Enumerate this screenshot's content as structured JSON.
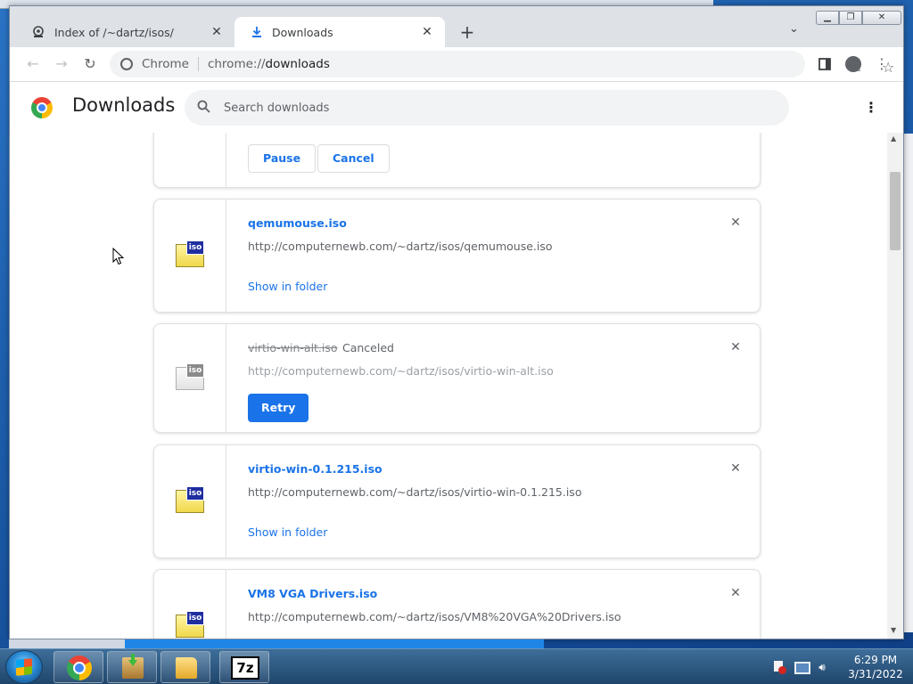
{
  "browser": {
    "tabs": [
      {
        "title": "Index of /~dartz/isos/",
        "icon": "page-icon"
      },
      {
        "title": "Downloads",
        "icon": "download-icon"
      }
    ],
    "omnibox": {
      "site_label": "Chrome",
      "url_scheme": "chrome://",
      "url_host": "downloads"
    }
  },
  "downloads_page": {
    "title": "Downloads",
    "search_placeholder": "Search downloads"
  },
  "active_download": {
    "pause_label": "Pause",
    "cancel_label": "Cancel"
  },
  "items": [
    {
      "name": "qemumouse.iso",
      "url": "http://computernewb.com/~dartz/isos/qemumouse.iso",
      "action": "Show in folder",
      "icon_tag": "iso",
      "state": "complete"
    },
    {
      "name": "virtio-win-alt.iso",
      "status": "Canceled",
      "url": "http://computernewb.com/~dartz/isos/virtio-win-alt.iso",
      "action": "Retry",
      "icon_tag": "iso",
      "state": "canceled"
    },
    {
      "name": "virtio-win-0.1.215.iso",
      "url": "http://computernewb.com/~dartz/isos/virtio-win-0.1.215.iso",
      "action": "Show in folder",
      "icon_tag": "iso",
      "state": "complete"
    },
    {
      "name": "VM8 VGA Drivers.iso",
      "url": "http://computernewb.com/~dartz/isos/VM8%20VGA%20Drivers.iso",
      "icon_tag": "iso",
      "state": "complete"
    }
  ],
  "taskbar": {
    "apps": [
      "chrome-icon",
      "installer-icon",
      "explorer-icon",
      "7zip-icon"
    ],
    "seven_zip_label": "7z",
    "clock_time": "6:29 PM",
    "clock_date": "3/31/2022"
  },
  "colors": {
    "accent": "#1a73e8",
    "text_secondary": "#5f6368",
    "taskbar": "#20456b"
  }
}
